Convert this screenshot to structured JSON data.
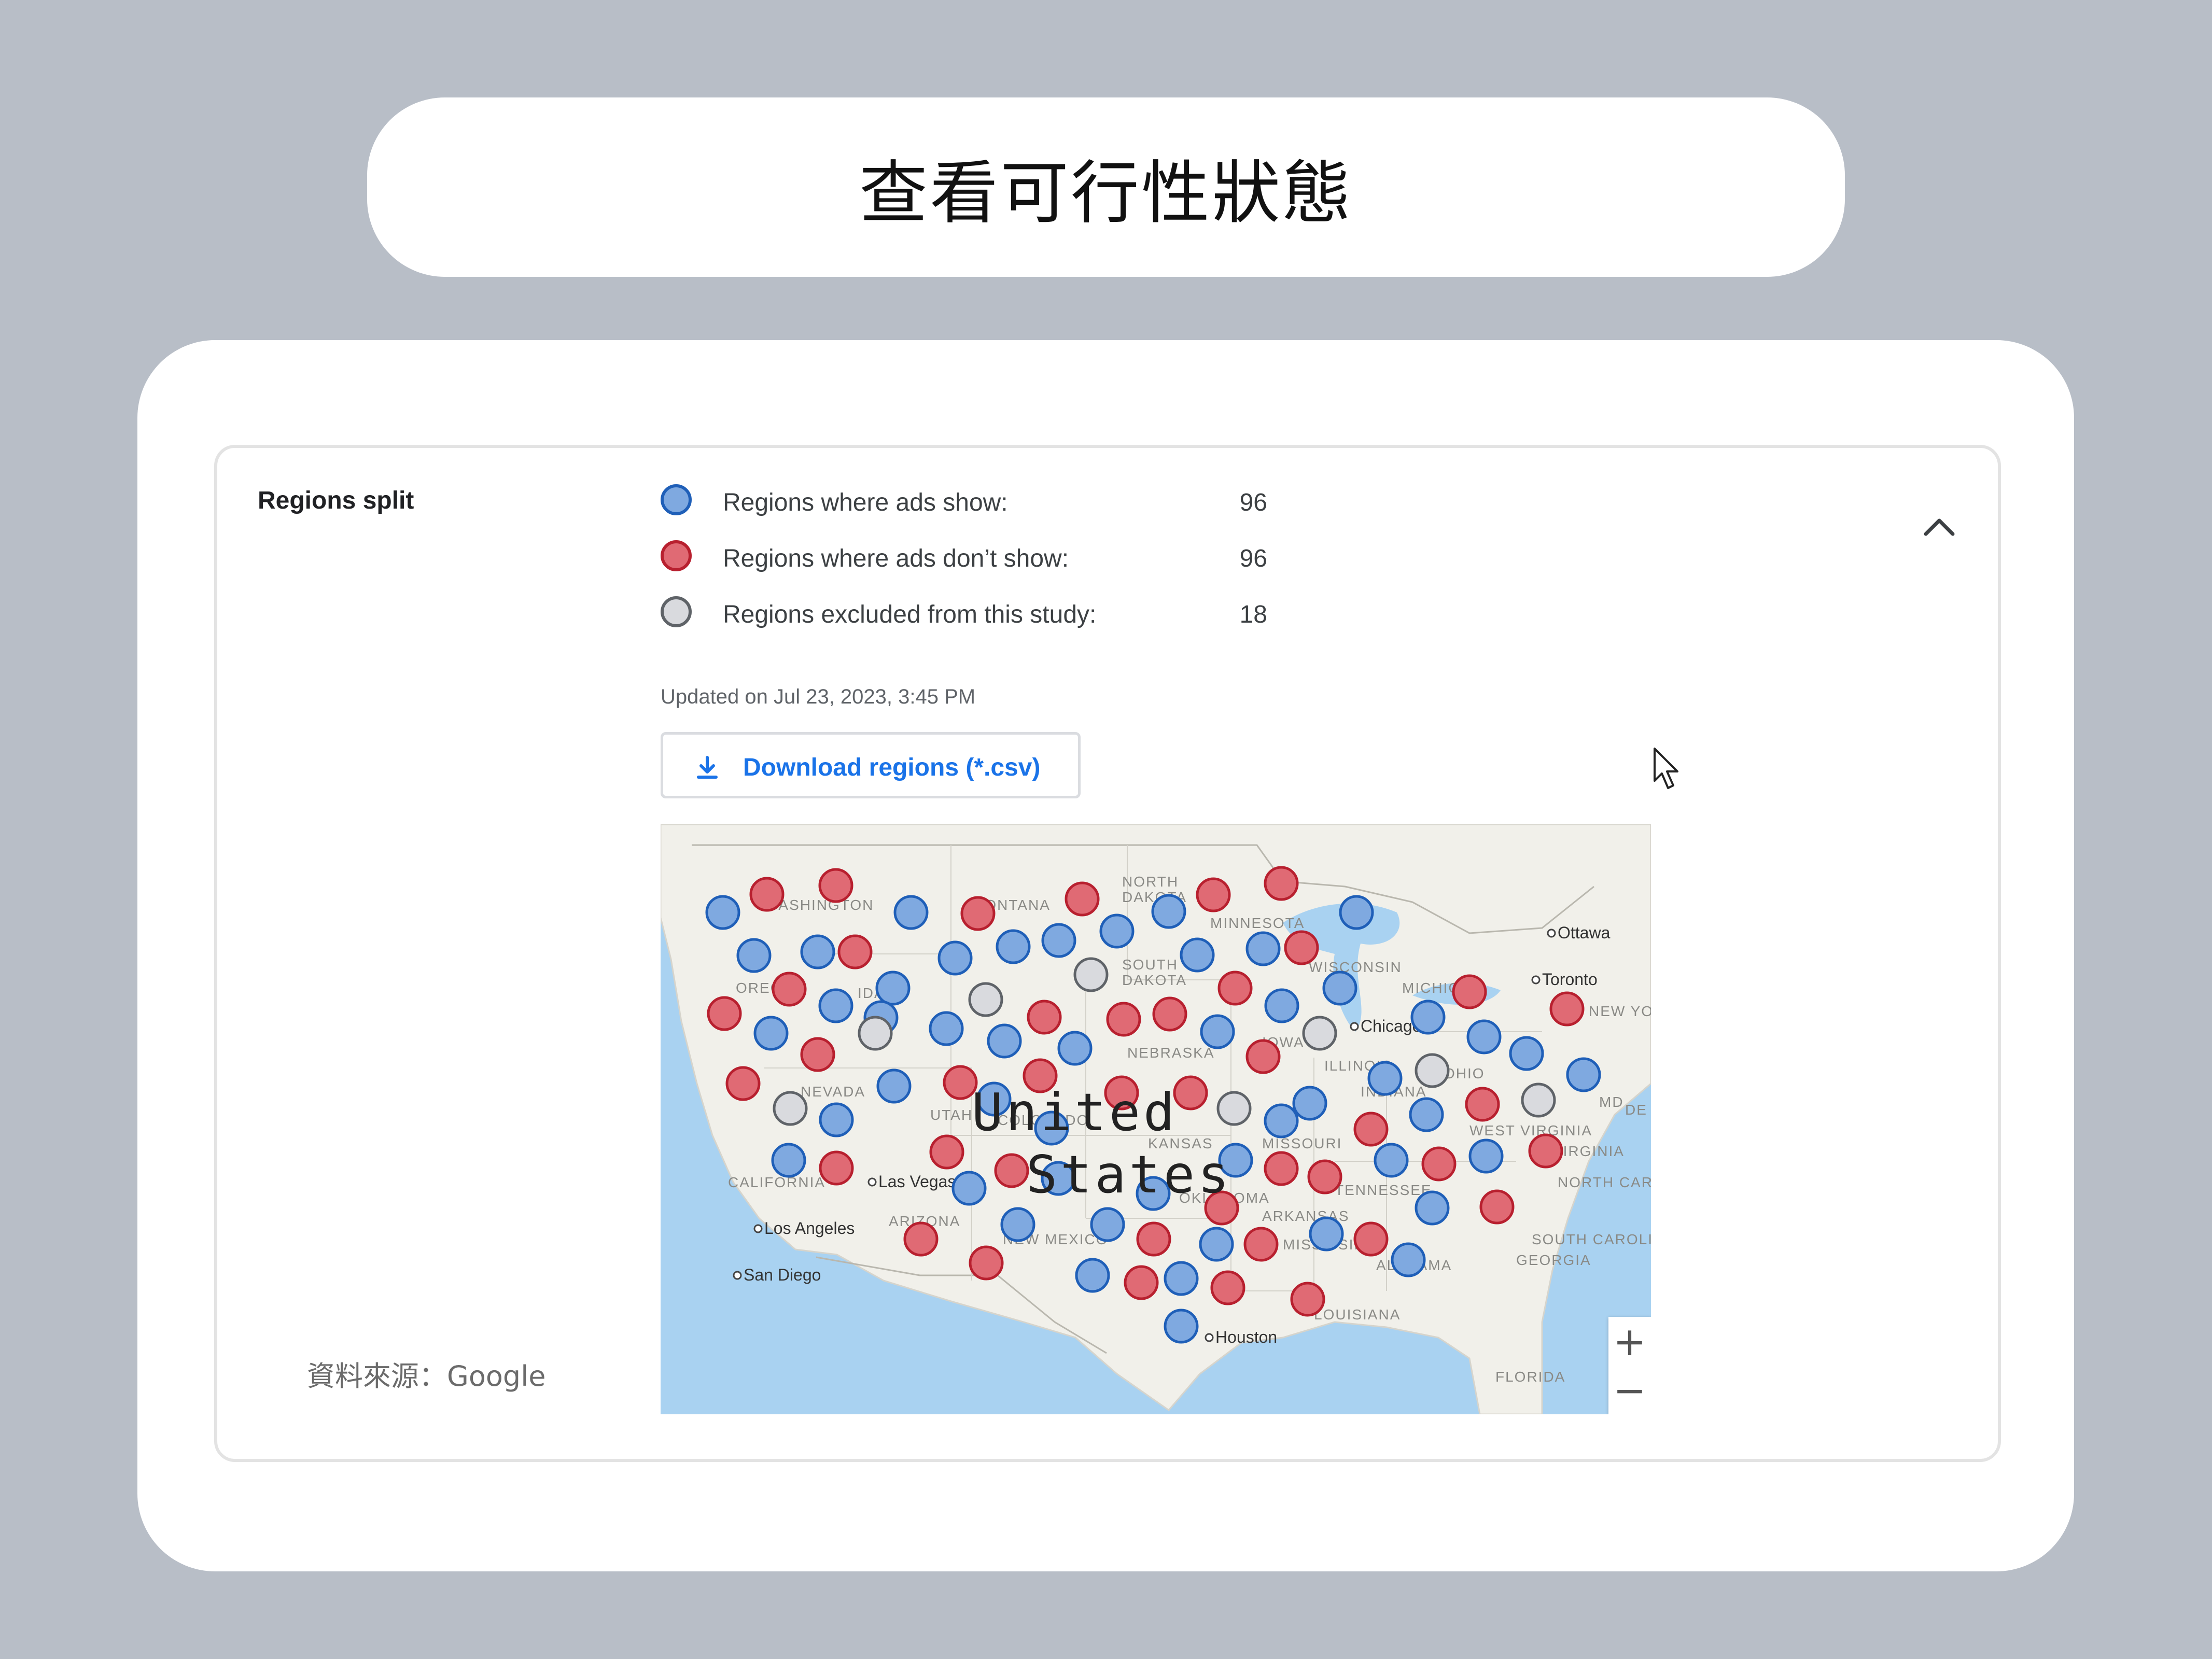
{
  "header": {
    "title": "查看可行性狀態"
  },
  "panel": {
    "section_label": "Regions split",
    "legend": [
      {
        "label": "Regions where ads show:",
        "count": "96",
        "color": "#7fa9e0",
        "border": "#1f5fb8"
      },
      {
        "label": "Regions where ads don’t show:",
        "count": "96",
        "color": "#e06a74",
        "border": "#b8202f"
      },
      {
        "label": "Regions excluded from this study:",
        "count": "18",
        "color": "#d9dade",
        "border": "#5f6368"
      }
    ],
    "updated": "Updated on Jul 23, 2023, 3:45 PM",
    "download_label": "Download regions (*.csv)",
    "collapse_icon": "chevron-up-icon"
  },
  "map": {
    "country_label_1": "United",
    "country_label_2": "States",
    "labels": [
      {
        "text": "NORTH"
      },
      {
        "text": "DAKOTA"
      },
      {
        "text": "MINNESOTA"
      },
      {
        "text": "SOUTH"
      },
      {
        "text": "DAKOTA"
      },
      {
        "text": "WISCONSIN"
      },
      {
        "text": "NEBRASKA"
      },
      {
        "text": "IOWA"
      },
      {
        "text": "ILLINOIS"
      },
      {
        "text": "KANSAS"
      },
      {
        "text": "MISSOURI"
      },
      {
        "text": "OKLAHOMA"
      },
      {
        "text": "ARKANSAS"
      },
      {
        "text": "TENNESSEE"
      },
      {
        "text": "NEVADA"
      },
      {
        "text": "UTAH"
      },
      {
        "text": "COLORADO"
      },
      {
        "text": "CALIFORNIA"
      },
      {
        "text": "ARIZONA"
      },
      {
        "text": "NEW MEXICO"
      },
      {
        "text": "MONTANA"
      },
      {
        "text": "WASHINGTON"
      },
      {
        "text": "OREGON"
      },
      {
        "text": "IDAHO"
      },
      {
        "text": "MICHIGAN"
      },
      {
        "text": "INDIANA"
      },
      {
        "text": "OHIO"
      },
      {
        "text": "WEST VIRGINIA"
      },
      {
        "text": "VIRGINIA"
      },
      {
        "text": "NORTH CAROLINA"
      },
      {
        "text": "SOUTH CAROLINA"
      },
      {
        "text": "GEORGIA"
      },
      {
        "text": "ALABAMA"
      },
      {
        "text": "LOUISIANA"
      },
      {
        "text": "FLORIDA"
      },
      {
        "text": "NEW YORK"
      },
      {
        "text": "MD"
      },
      {
        "text": "DE"
      },
      {
        "text": "MISSISSIPPI"
      }
    ],
    "cities": [
      {
        "text": "Ottawa"
      },
      {
        "text": "Toronto"
      },
      {
        "text": "Chicago"
      },
      {
        "text": "Las Vegas"
      },
      {
        "text": "Los Angeles"
      },
      {
        "text": "San Diego"
      },
      {
        "text": "Houston"
      }
    ],
    "zoom_in": "+",
    "zoom_out": "−"
  },
  "source": "資料來源：Google"
}
